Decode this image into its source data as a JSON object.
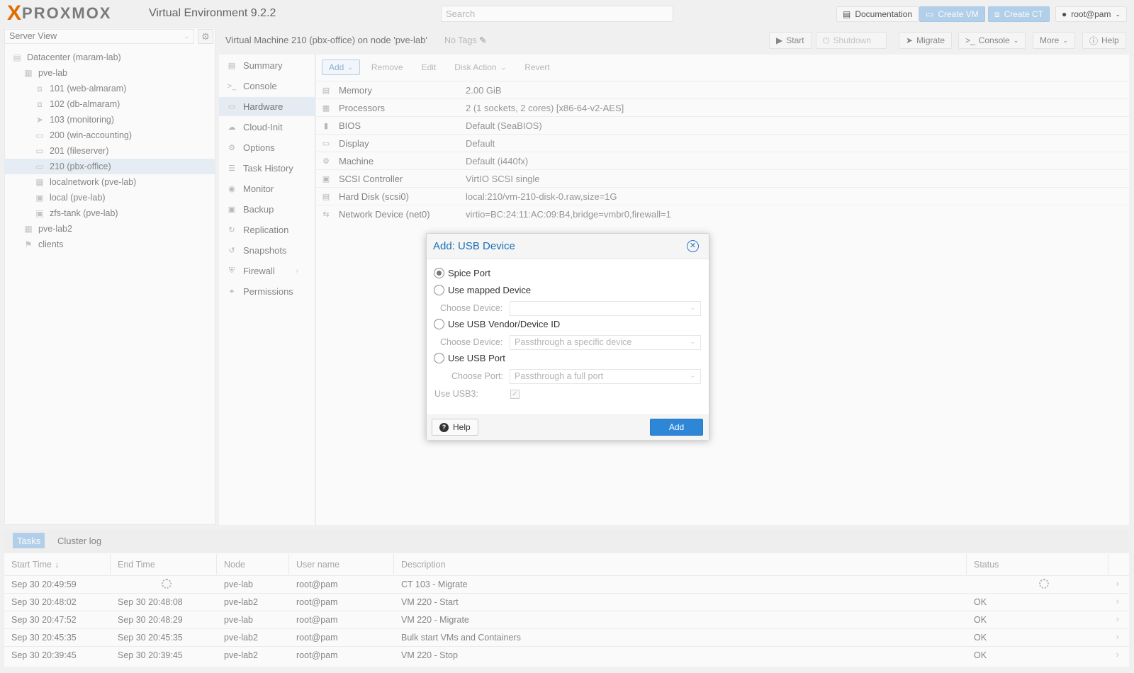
{
  "header": {
    "logo_x": "X",
    "logo_text": "PROXMOX",
    "version": "Virtual Environment 9.2.2",
    "search_placeholder": "Search",
    "documentation": "Documentation",
    "create_vm": "Create VM",
    "create_ct": "Create CT",
    "user": "root@pam"
  },
  "tree": {
    "view": "Server View",
    "items": [
      {
        "label": "Datacenter (maram-lab)",
        "icon": "datacenter-icon"
      },
      {
        "label": "pve-lab",
        "icon": "node-icon"
      },
      {
        "label": "101 (web-almaram)",
        "icon": "container-icon"
      },
      {
        "label": "102 (db-almaram)",
        "icon": "container-icon"
      },
      {
        "label": "103 (monitoring)",
        "icon": "container-migrating-icon"
      },
      {
        "label": "200 (win-accounting)",
        "icon": "vm-icon"
      },
      {
        "label": "201 (fileserver)",
        "icon": "vm-icon"
      },
      {
        "label": "210 (pbx-office)",
        "icon": "vm-icon"
      },
      {
        "label": "localnetwork (pve-lab)",
        "icon": "sdn-grid-icon"
      },
      {
        "label": "local (pve-lab)",
        "icon": "storage-icon"
      },
      {
        "label": "zfs-tank (pve-lab)",
        "icon": "storage-icon"
      },
      {
        "label": "pve-lab2",
        "icon": "node-icon"
      },
      {
        "label": "clients",
        "icon": "tags-icon"
      }
    ]
  },
  "content": {
    "title": "Virtual Machine 210 (pbx-office) on node 'pve-lab'",
    "no_tags": "No Tags",
    "buttons": {
      "start": "Start",
      "shutdown": "Shutdown",
      "migrate": "Migrate",
      "console": "Console",
      "more": "More",
      "help": "Help"
    }
  },
  "submenu": [
    {
      "label": "Summary",
      "icon": "summary-icon"
    },
    {
      "label": "Console",
      "icon": "terminal-icon"
    },
    {
      "label": "Hardware",
      "icon": "monitor-icon"
    },
    {
      "label": "Cloud-Init",
      "icon": "cloud-icon"
    },
    {
      "label": "Options",
      "icon": "gear-icon"
    },
    {
      "label": "Task History",
      "icon": "list-icon"
    },
    {
      "label": "Monitor",
      "icon": "eye-icon"
    },
    {
      "label": "Backup",
      "icon": "floppy-icon"
    },
    {
      "label": "Replication",
      "icon": "retweet-icon"
    },
    {
      "label": "Snapshots",
      "icon": "history-icon"
    },
    {
      "label": "Firewall",
      "icon": "shield-icon"
    },
    {
      "label": "Permissions",
      "icon": "unlock-icon"
    }
  ],
  "hardware": {
    "toolbar": {
      "add": "Add",
      "remove": "Remove",
      "edit": "Edit",
      "disk_action": "Disk Action",
      "revert": "Revert"
    },
    "rows": [
      {
        "name": "Memory",
        "value": "2.00 GiB",
        "icon": "memory-icon"
      },
      {
        "name": "Processors",
        "value": "2 (1 sockets, 2 cores) [x86-64-v2-AES]",
        "icon": "cpu-icon"
      },
      {
        "name": "BIOS",
        "value": "Default (SeaBIOS)",
        "icon": "microchip-icon"
      },
      {
        "name": "Display",
        "value": "Default",
        "icon": "desktop-icon"
      },
      {
        "name": "Machine",
        "value": "Default (i440fx)",
        "icon": "cogs-icon"
      },
      {
        "name": "SCSI Controller",
        "value": "VirtIO SCSI single",
        "icon": "database-icon"
      },
      {
        "name": "Hard Disk (scsi0)",
        "value": "local:210/vm-210-disk-0.raw,size=1G",
        "icon": "hdd-icon"
      },
      {
        "name": "Network Device (net0)",
        "value": "virtio=BC:24:11:AC:09:B4,bridge=vmbr0,firewall=1",
        "icon": "exchange-icon"
      }
    ]
  },
  "tasks": {
    "tabs": {
      "tasks": "Tasks",
      "cluster_log": "Cluster log"
    },
    "columns": [
      "Start Time",
      "End Time",
      "Node",
      "User name",
      "Description",
      "Status"
    ],
    "rows": [
      {
        "start": "Sep 30 20:49:59",
        "end": "",
        "node": "pve-lab",
        "user": "root@pam",
        "description": "CT 103 - Migrate",
        "status": ""
      },
      {
        "start": "Sep 30 20:48:02",
        "end": "Sep 30 20:48:08",
        "node": "pve-lab2",
        "user": "root@pam",
        "description": "VM 220 - Start",
        "status": "OK"
      },
      {
        "start": "Sep 30 20:47:52",
        "end": "Sep 30 20:48:29",
        "node": "pve-lab",
        "user": "root@pam",
        "description": "VM 220 - Migrate",
        "status": "OK"
      },
      {
        "start": "Sep 30 20:45:35",
        "end": "Sep 30 20:45:35",
        "node": "pve-lab2",
        "user": "root@pam",
        "description": "Bulk start VMs and Containers",
        "status": "OK"
      },
      {
        "start": "Sep 30 20:39:45",
        "end": "Sep 30 20:39:45",
        "node": "pve-lab2",
        "user": "root@pam",
        "description": "VM 220 - Stop",
        "status": "OK"
      }
    ]
  },
  "dialog": {
    "title": "Add: USB Device",
    "options": {
      "spice": "Spice Port",
      "mapped": "Use mapped Device",
      "vendor": "Use USB Vendor/Device ID",
      "port": "Use USB Port"
    },
    "choose_device": "Choose Device:",
    "choose_port": "Choose Port:",
    "vendor_placeholder": "Passthrough a specific device",
    "port_placeholder": "Passthrough a full port",
    "mapped_value": "",
    "use_usb3": "Use USB3:",
    "help": "Help",
    "add": "Add",
    "selected": "spice",
    "accent": "#2e86d6"
  }
}
